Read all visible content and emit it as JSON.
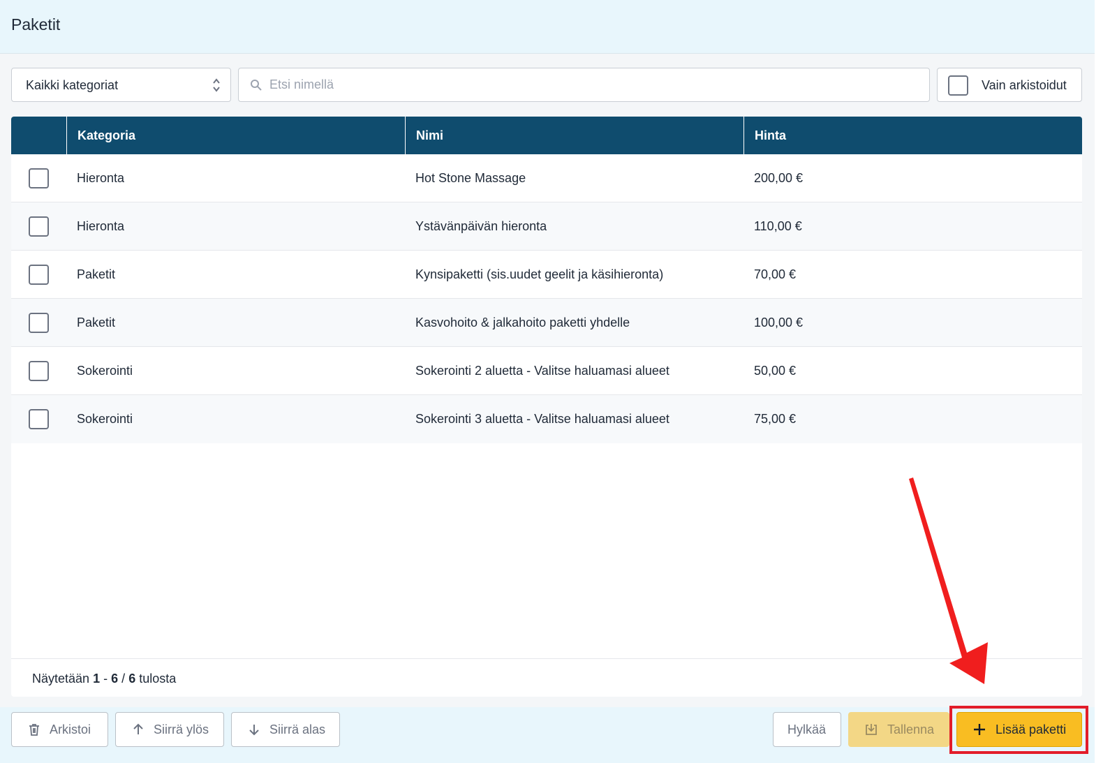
{
  "header": {
    "title": "Paketit"
  },
  "filters": {
    "category_select": "Kaikki kategoriat",
    "search_placeholder": "Etsi nimellä",
    "archived_label": "Vain arkistoidut"
  },
  "table": {
    "columns": [
      "",
      "Kategoria",
      "Nimi",
      "Hinta"
    ],
    "rows": [
      {
        "category": "Hieronta",
        "name": "Hot Stone Massage",
        "price": "200,00 €"
      },
      {
        "category": "Hieronta",
        "name": "Ystävänpäivän hieronta",
        "price": "110,00 €"
      },
      {
        "category": "Paketit",
        "name": "Kynsipaketti (sis.uudet geelit ja käsihieronta)",
        "price": "70,00 €"
      },
      {
        "category": "Paketit",
        "name": "Kasvohoito & jalkahoito paketti yhdelle",
        "price": "100,00 €"
      },
      {
        "category": "Sokerointi",
        "name": "Sokerointi 2 aluetta - Valitse haluamasi alueet",
        "price": "50,00 €"
      },
      {
        "category": "Sokerointi",
        "name": "Sokerointi 3 aluetta - Valitse haluamasi alueet",
        "price": "75,00 €"
      }
    ],
    "footer": {
      "prefix": "Näytetään",
      "from": "1",
      "sep1": "-",
      "to": "6",
      "sep2": "/",
      "total": "6",
      "suffix": "tulosta"
    }
  },
  "actions": {
    "archive": "Arkistoi",
    "move_up": "Siirrä ylös",
    "move_down": "Siirrä alas",
    "reject": "Hylkää",
    "save": "Tallenna",
    "add": "Lisää paketti"
  },
  "colors": {
    "header_bg": "#0f4c6e",
    "accent": "#f9bd22",
    "highlight": "#e21d2a"
  }
}
